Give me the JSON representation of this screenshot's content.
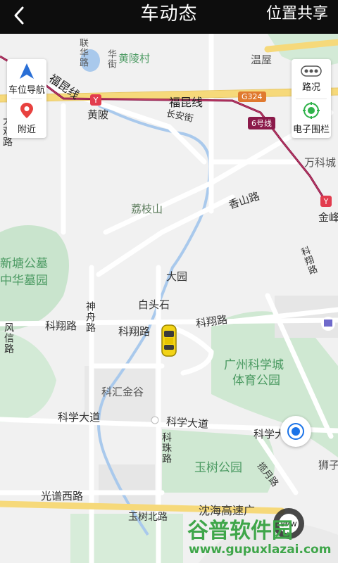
{
  "header": {
    "back_icon": "chevron-left-icon",
    "title": "车动态",
    "share_label": "位置共享"
  },
  "controls_left": [
    {
      "icon": "navigation-arrow-icon",
      "label": "车位导航"
    },
    {
      "icon": "location-pin-icon",
      "label": "附近"
    }
  ],
  "controls_right": [
    {
      "icon": "traffic-icon",
      "label": "路况"
    },
    {
      "icon": "geofence-icon",
      "label": "电子围栏"
    }
  ],
  "map": {
    "labels": {
      "huanglingcun": "黄陵村",
      "wenwu": "温屋",
      "lianhualu": "联华路",
      "huajie": "华街",
      "fukunxian1": "福昆线",
      "fukunxian2": "福昆线",
      "huangling": "黄陂",
      "changanjie": "长安街",
      "wankecheng": "万科城",
      "jinfeng": "金峰",
      "lizhishan": "荔枝山",
      "xiangshanlu": "香山路",
      "xintang": "新塘公墓",
      "zhonghua": "中华墓园",
      "dayuan": "大园",
      "baitoushi": "白头石",
      "kexianglu1": "科翔路",
      "kexianglu2": "科翔路",
      "kexianglu3": "科翔路",
      "kexianglu4": "科翔路",
      "shenzhoulu": "神舟路",
      "fengxinlu": "风信路",
      "kehuijingu": "科汇金谷",
      "sportspark": "广州科学城",
      "sportspark2": "体育公园",
      "kexuedadao1": "科学大道",
      "kexuedadao2": "科学大道",
      "kexuedadao3": "科学大",
      "kezhulu": "科珠路",
      "yushupark": "玉树公园",
      "lanyuelu": "揽月路",
      "shizi": "狮子",
      "guangpuxilu": "光谱西路",
      "shenhai": "沈海高速广",
      "yushubeilu": "玉树北路",
      "g324": "G324",
      "line6": "6号线",
      "dafengxian": "大观路"
    }
  },
  "watermark": {
    "cn": "谷普软件园",
    "url": "www.gupuxlazai.com"
  },
  "colors": {
    "header_bg": "#0d0d0d",
    "metro_line": "#8b1a4a",
    "road_yellow": "#f6d97a",
    "green_area": "#c9e4cd",
    "water": "#a9c9ec",
    "locate_blue": "#1a73e8",
    "car_yellow": "#f2d316"
  }
}
